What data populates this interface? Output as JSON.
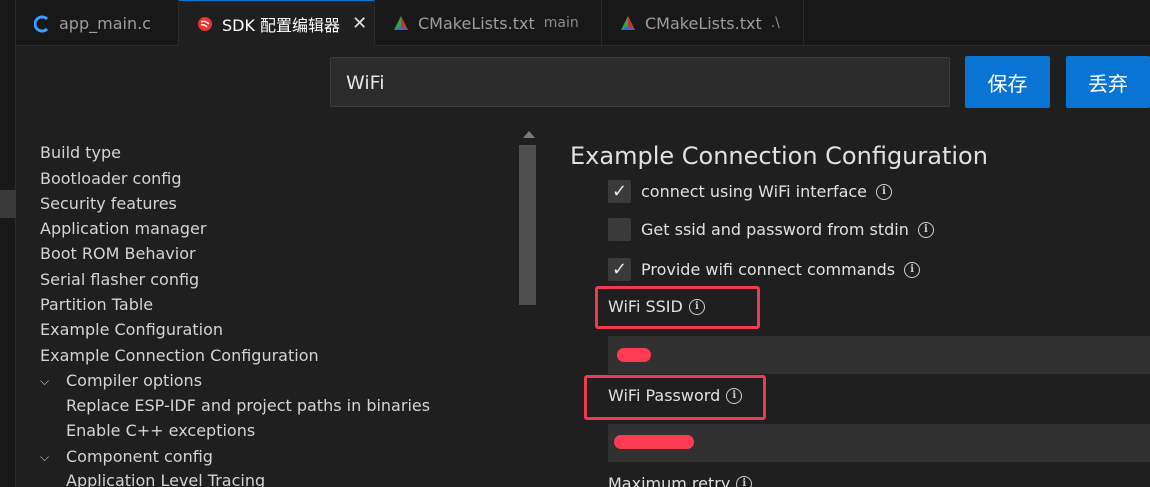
{
  "tabs": [
    {
      "label": "app_main.c",
      "sub": "",
      "icon": "c-language-icon"
    },
    {
      "label": "SDK 配置编辑器",
      "sub": "",
      "icon": "espressif-icon",
      "active": true,
      "close": "✕"
    },
    {
      "label": "CMakeLists.txt",
      "sub": "main",
      "icon": "cmake-icon"
    },
    {
      "label": "CMakeLists.txt",
      "sub": ".\\",
      "icon": "cmake-icon"
    }
  ],
  "search": {
    "value": "WiFi"
  },
  "buttons": {
    "save": "保存",
    "discard": "丢弃"
  },
  "tree": [
    "Build type",
    "Bootloader config",
    "Security features",
    "Application manager",
    "Boot ROM Behavior",
    "Serial flasher config",
    "Partition Table",
    "Example Configuration",
    "Example Connection Configuration",
    "Compiler options",
    "Replace ESP-IDF and project paths in binaries",
    "Enable C++ exceptions",
    "Component config",
    "Application Level Tracing"
  ],
  "content": {
    "title": "Example Connection Configuration",
    "options": [
      {
        "label": "connect using WiFi interface",
        "checked": true
      },
      {
        "label": "Get ssid and password from stdin",
        "checked": false
      },
      {
        "label": "Provide wifi connect commands",
        "checked": true
      }
    ],
    "fields": [
      {
        "label": "WiFi SSID"
      },
      {
        "label": "WiFi Password"
      },
      {
        "label": "Maximum retry"
      }
    ]
  },
  "colors": {
    "accent": "#0a74d4",
    "highlight": "#ef3b52",
    "background": "#1f1f1f"
  }
}
